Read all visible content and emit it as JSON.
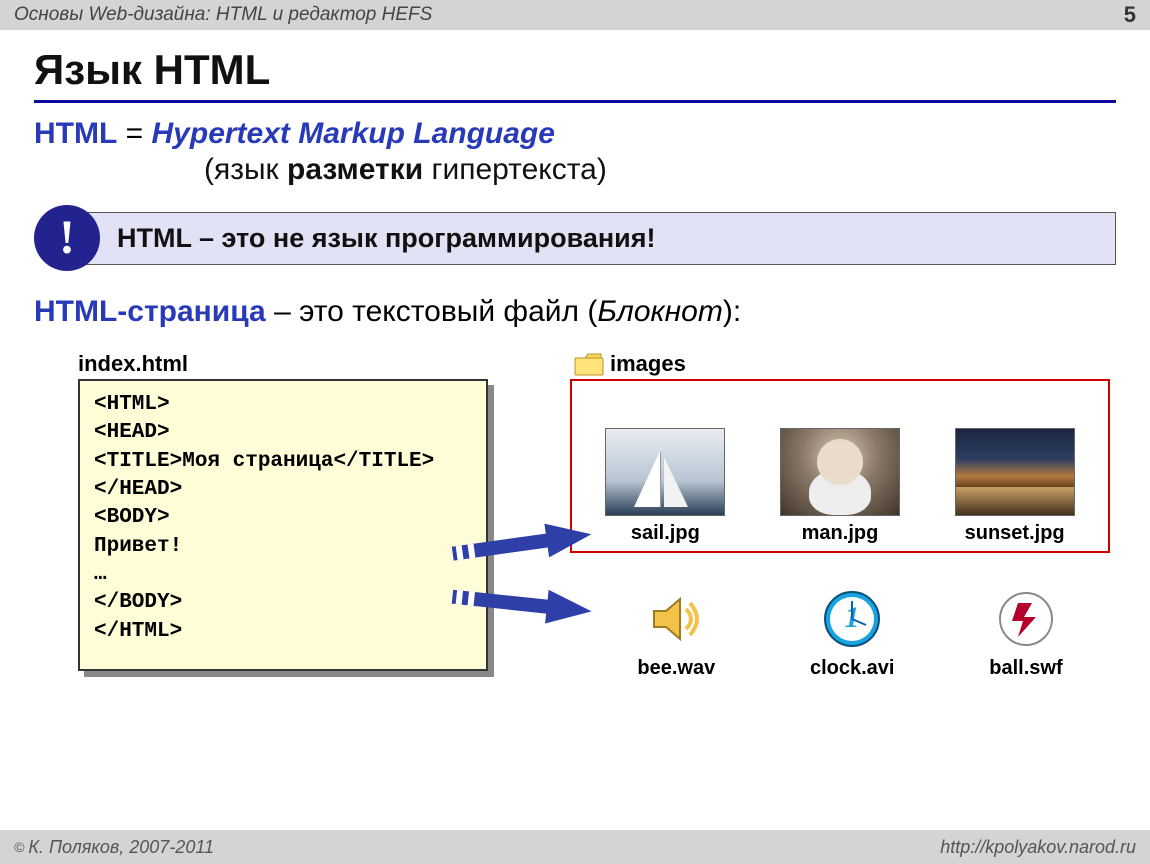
{
  "header": {
    "title": "Основы Web-дизайна: HTML и редактор HEFS",
    "page": "5"
  },
  "h1": "Язык HTML",
  "def_prefix": "HTML",
  "def_eq": " = ",
  "def_expansion": "Hypertext Markup Language",
  "trans_open": "(язык ",
  "trans_bold": "разметки",
  "trans_close": " гипертекста)",
  "bang": "!",
  "note": "HTML – это не язык программирования!",
  "page_prefix": "HTML-страница",
  "page_mid": " – это текстовый файл (",
  "page_it": "Блокнот",
  "page_close": "):",
  "code_label": "index.html",
  "code": "<HTML>\n<HEAD>\n<TITLE>Моя страница</TITLE>\n</HEAD>\n<BODY>\nПривет!\n…\n</BODY>\n</HTML>",
  "folder_label": "images",
  "thumbs": {
    "a": "sail.jpg",
    "b": "man.jpg",
    "c": "sunset.jpg"
  },
  "files": {
    "a": "bee.wav",
    "b": "clock.avi",
    "c": "ball.swf"
  },
  "footer": {
    "author": "К. Поляков, 2007-2011",
    "url": "http://kpolyakov.narod.ru"
  }
}
